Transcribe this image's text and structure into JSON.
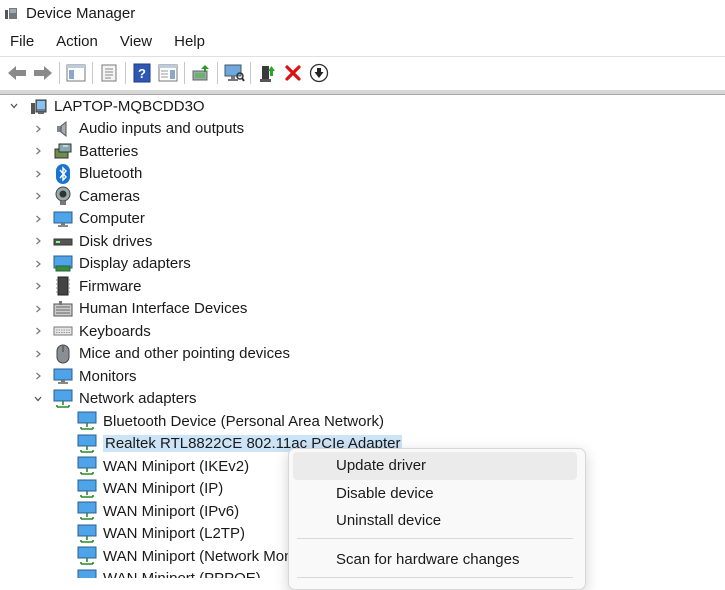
{
  "window": {
    "title": "Device Manager"
  },
  "menu": [
    "File",
    "Action",
    "View",
    "Help"
  ],
  "toolbar": {
    "buttons": [
      "back-icon",
      "forward-icon",
      "show-hide-tree-icon",
      "properties-icon",
      "help-icon",
      "action-pane-icon",
      "update-driver-icon",
      "scan-hardware-icon",
      "enable-device-icon",
      "uninstall-device-icon",
      "disable-device-icon"
    ]
  },
  "tree": {
    "root": "LAPTOP-MQBCDD3O",
    "categories": [
      "Audio inputs and outputs",
      "Batteries",
      "Bluetooth",
      "Cameras",
      "Computer",
      "Disk drives",
      "Display adapters",
      "Firmware",
      "Human Interface Devices",
      "Keyboards",
      "Mice and other pointing devices",
      "Monitors",
      "Network adapters"
    ],
    "network_adapters": [
      "Bluetooth Device (Personal Area Network)",
      "Realtek RTL8822CE 802.11ac PCIe Adapter",
      "WAN Miniport (IKEv2)",
      "WAN Miniport (IP)",
      "WAN Miniport (IPv6)",
      "WAN Miniport (L2TP)",
      "WAN Miniport (Network Monitor)",
      "WAN Miniport (PPPOE)"
    ]
  },
  "context_menu": {
    "items": [
      "Update driver",
      "Disable device",
      "Uninstall device",
      "Scan for hardware changes"
    ]
  },
  "colors": {
    "selection": "#cce4f7",
    "menu_hover": "#ebebeb",
    "delete_red": "#e01010",
    "accent_blue": "#1a73d0"
  }
}
